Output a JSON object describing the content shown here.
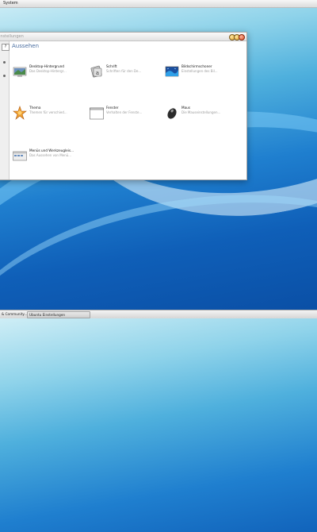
{
  "top_panel": {
    "menu_label": "System"
  },
  "window": {
    "title": "instellungen",
    "sidebar": {
      "search_glyph": "?"
    },
    "heading": "Aussehen",
    "items": [
      {
        "name": "Desktop-Hintergrund",
        "desc": "Das Desktop-Hintergr...",
        "icon": "desktop-background-icon"
      },
      {
        "name": "Schrift",
        "desc": "Schriften für den De...",
        "icon": "font-icon"
      },
      {
        "name": "Bildschirmschoner",
        "desc": "Einstellungen des Bil...",
        "icon": "screensaver-icon"
      },
      {
        "name": "Thema",
        "desc": "Themen für verschied...",
        "icon": "theme-icon"
      },
      {
        "name": "Fenster",
        "desc": "Verhalten der Fenste...",
        "icon": "window-icon"
      },
      {
        "name": "Maus",
        "desc": "Die Mauseinstellungen...",
        "icon": "mouse-icon"
      },
      {
        "name": "Menüs und Werkzeugleis...",
        "desc": "Das Aussehen von Menü...",
        "icon": "menu-toolbar-icon"
      }
    ]
  },
  "taskbar": {
    "tasks": [
      {
        "label": "& Community..."
      },
      {
        "label": "Ubuntu Einstellungen"
      }
    ]
  },
  "colors": {
    "heading": "#4a6ea0",
    "desc": "#9c9c9c"
  }
}
